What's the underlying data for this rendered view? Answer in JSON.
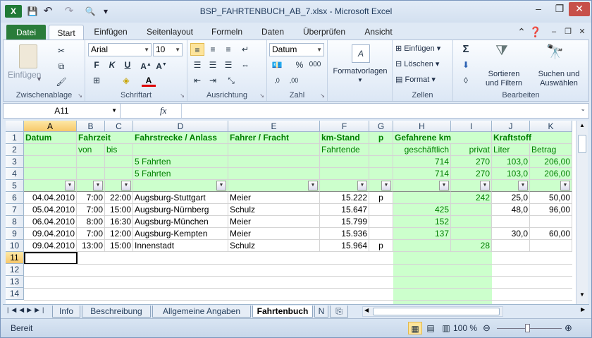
{
  "title": {
    "text": "BSP_FAHRTENBUCH_AB_7.xlsx  -  Microsoft Excel"
  },
  "quick_access": {
    "save": "💾",
    "undo": "↶",
    "redo": "↷",
    "print_preview": "🔍",
    "more": "▾"
  },
  "tabs": {
    "file": "Datei",
    "start": "Start",
    "insert": "Einfügen",
    "layout": "Seitenlayout",
    "formulas": "Formeln",
    "data": "Daten",
    "review": "Überprüfen",
    "view": "Ansicht"
  },
  "ribbon": {
    "clipboard": {
      "label": "Zwischenablage",
      "paste": "Einfügen"
    },
    "font": {
      "label": "Schriftart",
      "name": "Arial",
      "size": "10",
      "bold": "F",
      "italic": "K",
      "underline": "U"
    },
    "align": {
      "label": "Ausrichtung"
    },
    "number": {
      "label": "Zahl",
      "format": "Datum",
      "percent": "%",
      "thousands": "000"
    },
    "styles": {
      "label": "Formatvorlagen"
    },
    "cells": {
      "label": "Zellen",
      "insert": "Einfügen",
      "delete": "Löschen",
      "format": "Format"
    },
    "edit": {
      "label": "Bearbeiten",
      "sort": "Sortieren und Filtern",
      "find": "Suchen und Auswählen",
      "sigma": "Σ"
    }
  },
  "formula_bar": {
    "name_box": "A11",
    "fx": "fx",
    "value": ""
  },
  "columns": [
    "A",
    "B",
    "C",
    "D",
    "E",
    "F",
    "G",
    "H",
    "I",
    "J",
    "K"
  ],
  "rows": [
    "1",
    "2",
    "3",
    "4",
    "5",
    "6",
    "7",
    "8",
    "9",
    "10",
    "11",
    "12",
    "13",
    "14"
  ],
  "headers": {
    "date": "Datum",
    "time": "Fahrzeit",
    "from": "von",
    "to": "bis",
    "route": "Fahrstrecke / Anlass",
    "driver": "Fahrer / Fracht",
    "km": "km-Stand",
    "km_sub": "Fahrtende",
    "p": "p",
    "driven": "Gefahrene km",
    "business": "geschäftlich",
    "private": "privat",
    "fuel": "Kraftstoff",
    "liter": "Liter",
    "amount": "Betrag"
  },
  "summary": {
    "trips": "5 Fahrten",
    "business": "714",
    "private": "270",
    "liter": "103,0",
    "amount": "206,00"
  },
  "data_rows": [
    {
      "date": "04.04.2010",
      "from": "7:00",
      "to": "22:00",
      "route": "Augsburg-Stuttgart",
      "driver": "Meier",
      "km": "15.222",
      "p": "p",
      "business": "",
      "private": "242",
      "liter": "25,0",
      "amount": "50,00"
    },
    {
      "date": "05.04.2010",
      "from": "7:00",
      "to": "15:00",
      "route": "Augsburg-Nürnberg",
      "driver": "Schulz",
      "km": "15.647",
      "p": "",
      "business": "425",
      "private": "",
      "liter": "48,0",
      "amount": "96,00"
    },
    {
      "date": "06.04.2010",
      "from": "8:00",
      "to": "16:30",
      "route": "Augsburg-München",
      "driver": "Meier",
      "km": "15.799",
      "p": "",
      "business": "152",
      "private": "",
      "liter": "",
      "amount": ""
    },
    {
      "date": "09.04.2010",
      "from": "7:00",
      "to": "12:00",
      "route": "Augsburg-Kempten",
      "driver": "Meier",
      "km": "15.936",
      "p": "",
      "business": "137",
      "private": "",
      "liter": "30,0",
      "amount": "60,00"
    },
    {
      "date": "09.04.2010",
      "from": "13:00",
      "to": "15:00",
      "route": "Innenstadt",
      "driver": "Schulz",
      "km": "15.964",
      "p": "p",
      "business": "",
      "private": "28",
      "liter": "",
      "amount": ""
    }
  ],
  "sheets": {
    "info": "Info",
    "desc": "Beschreibung",
    "general": "Allgemeine Angaben",
    "logbook": "Fahrtenbuch",
    "next": "N"
  },
  "status": {
    "ready": "Bereit",
    "zoom": "100 %"
  },
  "colors": {
    "green_fill": "#ccffcc",
    "green_text": "#008000",
    "file_tab": "#2a7c3a"
  }
}
